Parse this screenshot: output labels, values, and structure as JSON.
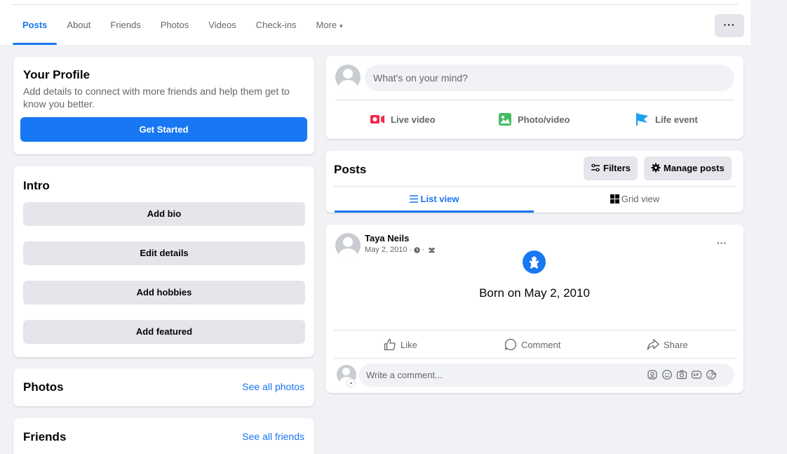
{
  "nav": {
    "tabs": [
      {
        "label": "Posts",
        "active": true
      },
      {
        "label": "About"
      },
      {
        "label": "Friends"
      },
      {
        "label": "Photos"
      },
      {
        "label": "Videos"
      },
      {
        "label": "Check-ins"
      },
      {
        "label": "More"
      }
    ],
    "more_caret": "▾",
    "options_label": "···"
  },
  "profile": {
    "title": "Your Profile",
    "description": "Add details to connect with more friends and help them get to know you better.",
    "button": "Get Started"
  },
  "intro": {
    "title": "Intro",
    "buttons": [
      "Add bio",
      "Edit details",
      "Add hobbies",
      "Add featured"
    ]
  },
  "photos": {
    "title": "Photos",
    "link": "See all photos"
  },
  "friends": {
    "title": "Friends",
    "link": "See all friends"
  },
  "composer": {
    "placeholder": "What's on your mind?",
    "actions": [
      "Live video",
      "Photo/video",
      "Life event"
    ]
  },
  "posts_header": {
    "title": "Posts",
    "filters": "Filters",
    "manage": "Manage posts",
    "list_view": "List view",
    "grid_view": "Grid view"
  },
  "post": {
    "author": "Taya Neils",
    "date": "May 2, 2010 ·",
    "dot": "·",
    "more": "···",
    "event_text": "Born on May 2, 2010",
    "like": "Like",
    "comment": "Comment",
    "share": "Share",
    "comment_placeholder": "Write a comment..."
  },
  "colors": {
    "accent": "#1877f2",
    "live_red": "#f02849",
    "photo_green": "#45bd62",
    "flag_blue": "#1ea1f2"
  }
}
